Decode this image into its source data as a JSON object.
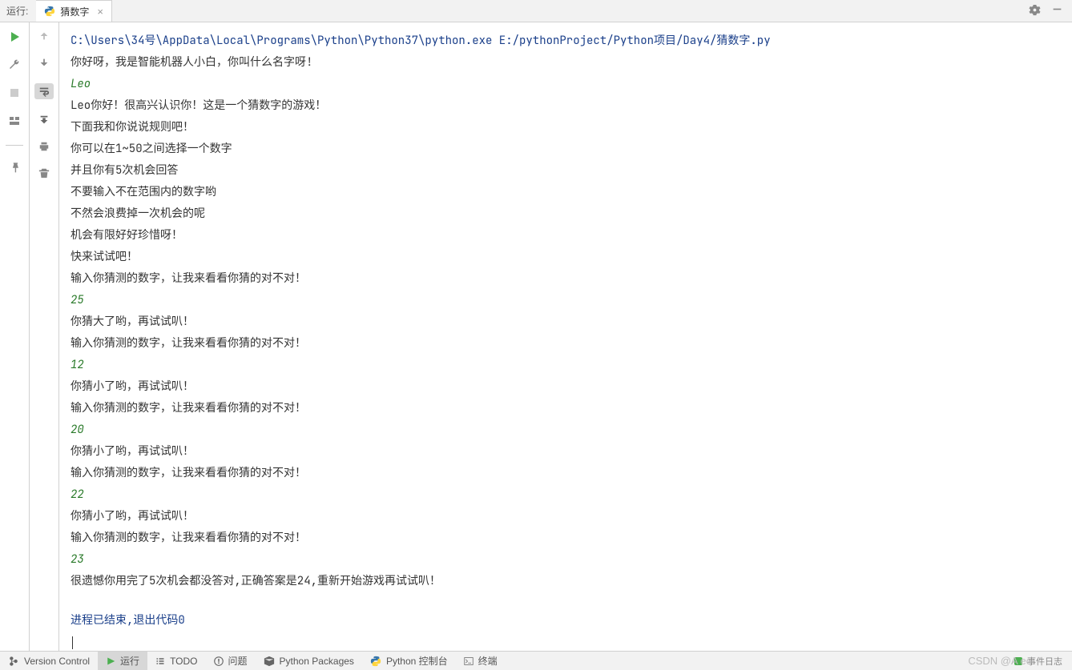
{
  "header": {
    "run_label": "运行:",
    "tab_name": "猜数字"
  },
  "console": {
    "path": "C:\\Users\\34号\\AppData\\Local\\Programs\\Python\\Python37\\python.exe  E:/pythonProject/Python项目/Day4/猜数字.py",
    "lines": [
      {
        "t": "你好呀，我是智能机器人小白，你叫什么名字呀!",
        "c": "out"
      },
      {
        "t": "Leo",
        "c": "in"
      },
      {
        "t": "Leo你好！很高兴认识你！这是一个猜数字的游戏！",
        "c": "out"
      },
      {
        "t": "下面我和你说说规则吧！",
        "c": "out"
      },
      {
        "t": "你可以在1~50之间选择一个数字",
        "c": "out"
      },
      {
        "t": "并且你有5次机会回答",
        "c": "out"
      },
      {
        "t": "不要输入不在范围内的数字哟",
        "c": "out"
      },
      {
        "t": "不然会浪费掉一次机会的呢",
        "c": "out"
      },
      {
        "t": "机会有限好好珍惜呀！",
        "c": "out"
      },
      {
        "t": "快来试试吧！",
        "c": "out"
      },
      {
        "t": "输入你猜测的数字，让我来看看你猜的对不对！",
        "c": "out"
      },
      {
        "t": "25",
        "c": "in"
      },
      {
        "t": "你猜大了哟，再试试叭！",
        "c": "out"
      },
      {
        "t": "输入你猜测的数字，让我来看看你猜的对不对！",
        "c": "out"
      },
      {
        "t": "12",
        "c": "in"
      },
      {
        "t": "你猜小了哟，再试试叭！",
        "c": "out"
      },
      {
        "t": "输入你猜测的数字，让我来看看你猜的对不对！",
        "c": "out"
      },
      {
        "t": "20",
        "c": "in"
      },
      {
        "t": "你猜小了哟，再试试叭！",
        "c": "out"
      },
      {
        "t": "输入你猜测的数字，让我来看看你猜的对不对！",
        "c": "out"
      },
      {
        "t": "22",
        "c": "in"
      },
      {
        "t": "你猜小了哟，再试试叭！",
        "c": "out"
      },
      {
        "t": "输入你猜测的数字，让我来看看你猜的对不对！",
        "c": "out"
      },
      {
        "t": "23",
        "c": "in"
      },
      {
        "t": "很遗憾你用完了5次机会都没答对,正确答案是24,重新开始游戏再试试叭！",
        "c": "out"
      }
    ],
    "final": "进程已结束,退出代码0"
  },
  "bottom": {
    "version_control": "Version Control",
    "run": "运行",
    "todo": "TODO",
    "problems": "问题",
    "packages": "Python Packages",
    "console": "Python 控制台",
    "terminal": "终端",
    "event_log": "事件日志"
  },
  "watermark": "CSDN @A                  eo"
}
